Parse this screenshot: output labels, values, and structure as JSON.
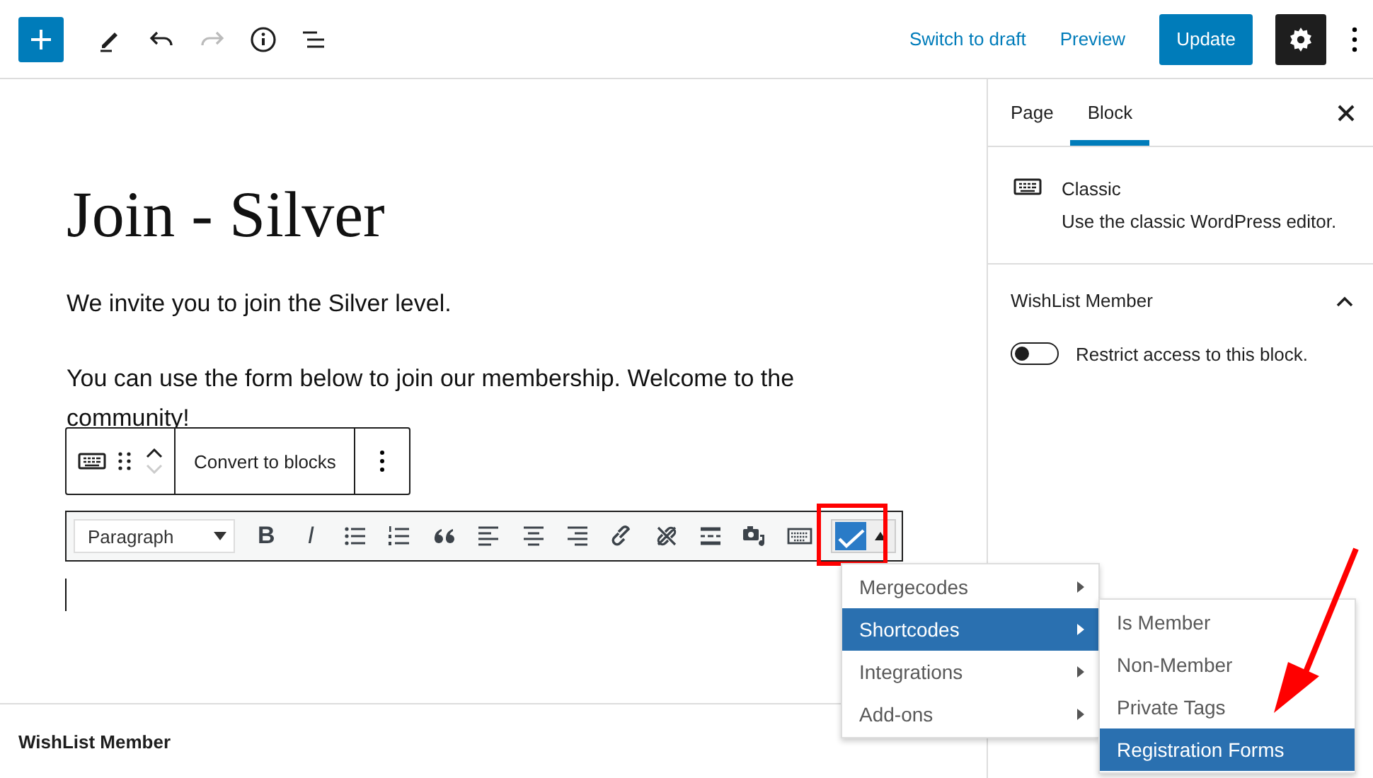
{
  "top_bar": {
    "redo_disabled": true,
    "links": [
      "Switch to draft",
      "Preview"
    ],
    "primary_button": "Update",
    "settings_active": true
  },
  "editor": {
    "title": "Join - Silver",
    "paragraphs": [
      "We invite you to join the Silver level.",
      "You can use the form below to join our membership. Welcome to the community!"
    ],
    "block_toolbar": {
      "move_down_disabled": true,
      "button": "Convert to blocks"
    },
    "classic_toolbar": {
      "format": "Paragraph",
      "format_buttons": [
        {
          "kind": "bold",
          "label": "B"
        },
        {
          "kind": "italic",
          "label": "I"
        }
      ],
      "plugin_button_highlighted": true
    },
    "menu": {
      "items": [
        {
          "label": "Mergecodes",
          "selected": false
        },
        {
          "label": "Shortcodes",
          "selected": true
        },
        {
          "label": "Integrations",
          "selected": false
        },
        {
          "label": "Add-ons",
          "selected": false
        }
      ]
    },
    "submenu": {
      "items": [
        {
          "label": "Is Member",
          "selected": false
        },
        {
          "label": "Non-Member",
          "selected": false
        },
        {
          "label": "Private Tags",
          "selected": false
        },
        {
          "label": "Registration Forms",
          "selected": true
        }
      ]
    },
    "footer": "WishList Member"
  },
  "sidebar": {
    "tabs": [
      {
        "label": "Page",
        "selected": false
      },
      {
        "label": "Block",
        "selected": true
      }
    ],
    "block": {
      "title": "Classic",
      "description": "Use the classic WordPress editor."
    },
    "panel": {
      "title": "WishList Member",
      "expanded": true,
      "toggle": {
        "label": "Restrict access to this block.",
        "on": false
      }
    }
  }
}
